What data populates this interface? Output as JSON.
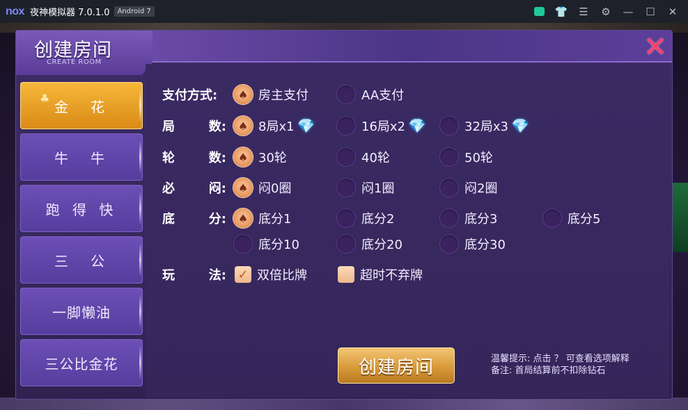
{
  "titlebar": {
    "logo": "nox",
    "title": "夜神模拟器 7.0.1.0",
    "android_badge": "Android 7",
    "icons": [
      "store-icon",
      "shirt-icon",
      "menu-icon",
      "settings-icon",
      "minimize-icon",
      "maximize-icon",
      "close-icon"
    ],
    "glyphs": {
      "shirt": "👕",
      "menu": "☰",
      "settings": "⚙",
      "minimize": "—",
      "maximize": "☐",
      "close": "✕"
    }
  },
  "dialog": {
    "title": "创建房间",
    "subtitle": "CREATE ROOM",
    "close_glyph": "✕"
  },
  "side_menu": [
    {
      "label": "金　花",
      "active": true
    },
    {
      "label": "牛　牛",
      "active": false
    },
    {
      "label": "跑 得 快",
      "active": false
    },
    {
      "label": "三　公",
      "active": false
    },
    {
      "label": "一脚懒油",
      "active": false
    },
    {
      "label": "三公比金花",
      "active": false
    }
  ],
  "options": {
    "payment": {
      "label": "支付方式:",
      "choices": [
        "房主支付",
        "AA支付"
      ],
      "selected": 0
    },
    "rounds": {
      "label_a": "局",
      "label_b": "数:",
      "choices": [
        "8局x1",
        "16局x2",
        "32局x3"
      ],
      "selected": 0
    },
    "turns": {
      "label_a": "轮",
      "label_b": "数:",
      "choices": [
        "30轮",
        "40轮",
        "50轮"
      ],
      "selected": 0
    },
    "blind": {
      "label_a": "必",
      "label_b": "闷:",
      "choices": [
        "闷0圈",
        "闷1圈",
        "闷2圈"
      ],
      "selected": 0
    },
    "base": {
      "label_a": "底",
      "label_b": "分:",
      "choices": [
        "底分1",
        "底分2",
        "底分3",
        "底分5",
        "底分10",
        "底分20",
        "底分30"
      ],
      "selected": 0
    },
    "play": {
      "label_a": "玩",
      "label_b": "法:",
      "choices": [
        "双倍比牌",
        "超时不弃牌"
      ],
      "checked": [
        true,
        false
      ]
    }
  },
  "create_button": "创建房间",
  "tips": {
    "line1": "温馨提示: 点击 ？ 可查看选项解释",
    "line2": "备注: 首局结算前不扣除钻石"
  },
  "glyphs": {
    "spade": "♠",
    "club": "♣",
    "check": "✓",
    "diamond": "💎"
  },
  "colors": {
    "accent_gold": "#f6b83a",
    "panel_purple": "#3a2a63",
    "close_red": "#ff3f6a"
  }
}
